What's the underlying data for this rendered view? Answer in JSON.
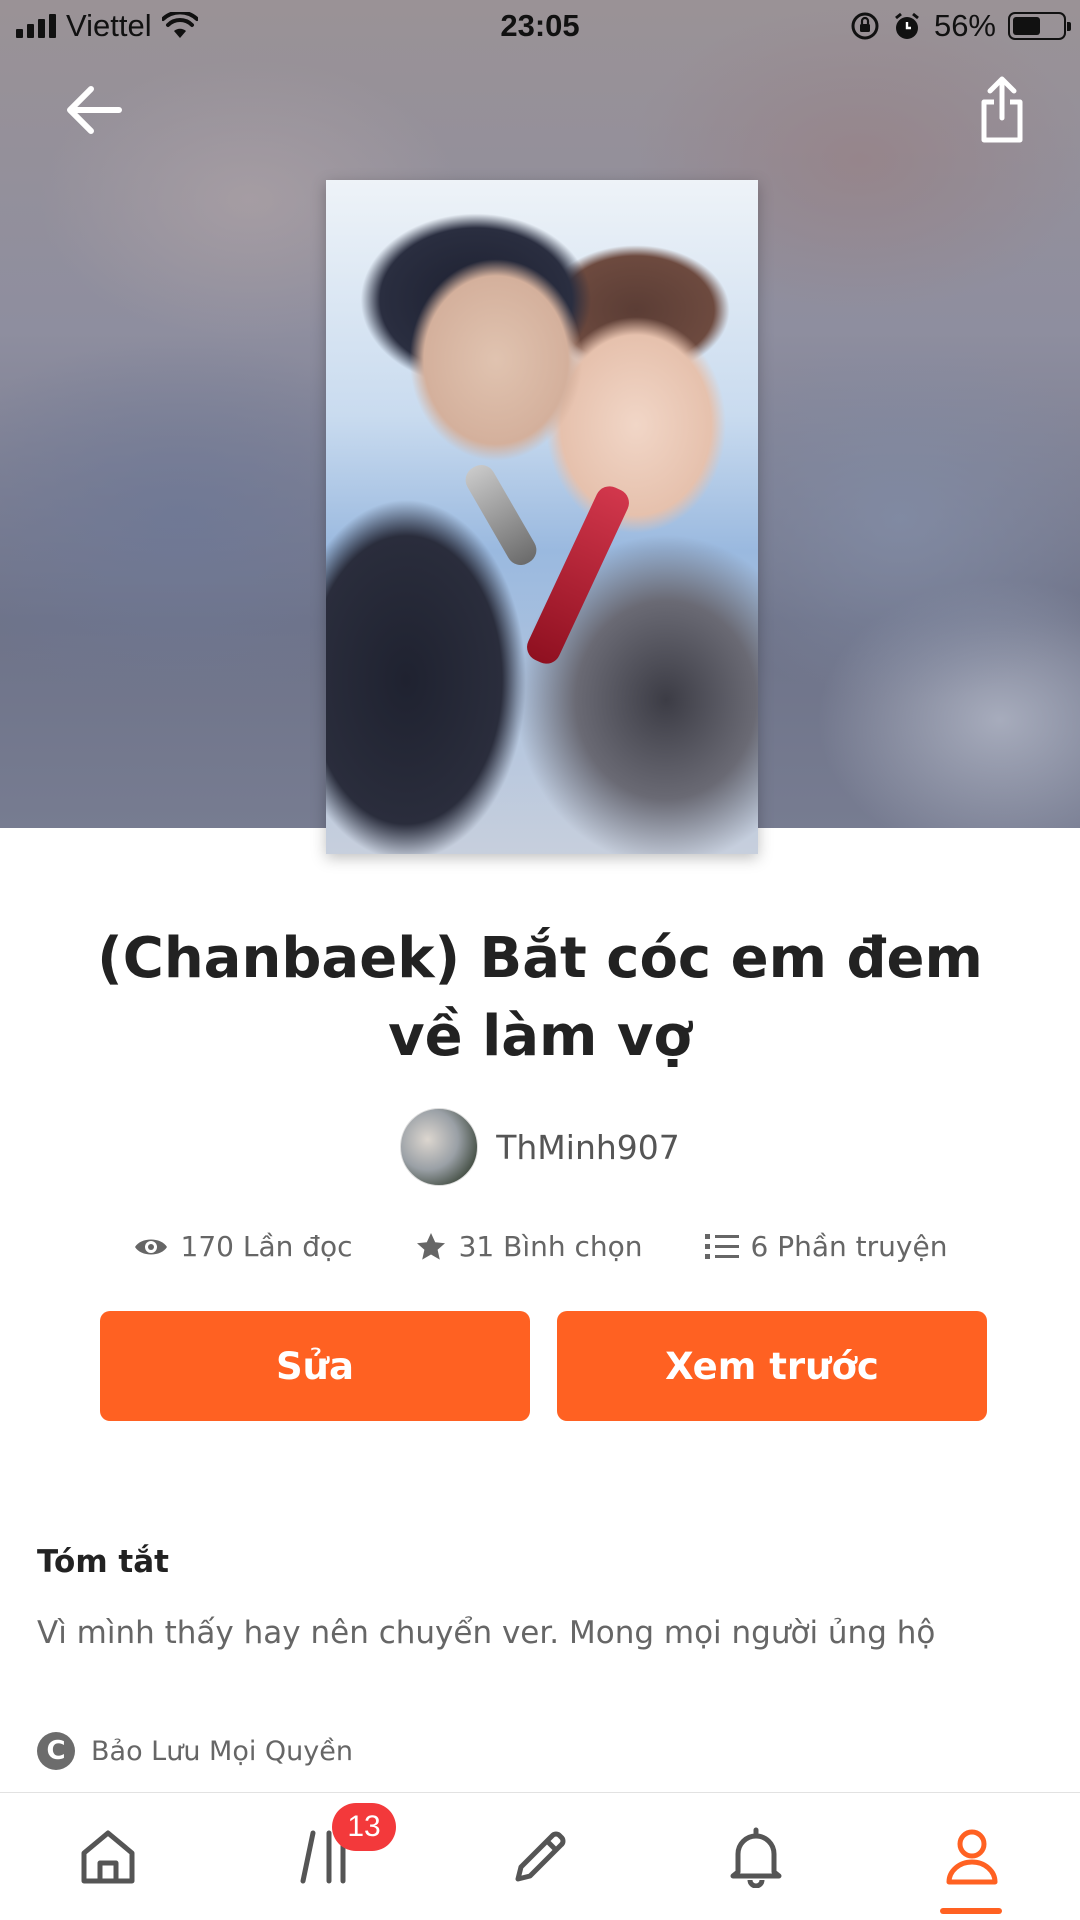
{
  "status_bar": {
    "carrier": "Viettel",
    "time": "23:05",
    "battery": "56%",
    "battery_level": 0.56
  },
  "header": {
    "back_icon": "arrow-left-icon",
    "share_icon": "share-icon"
  },
  "story": {
    "title": "(Chanbaek) Bắt cóc em đem về làm vợ",
    "author": "ThMinh907",
    "stats": {
      "reads": "170 Lần đọc",
      "votes": "31 Bình chọn",
      "parts": "6 Phần truyện"
    }
  },
  "actions": {
    "edit_label": "Sửa",
    "preview_label": "Xem trước"
  },
  "summary": {
    "heading": "Tóm tắt",
    "text": "Vì mình thấy hay nên chuyển ver. Mong mọi người ủng hộ",
    "rights": "Bảo Lưu Mọi Quyền",
    "rights_icon_glyph": "C"
  },
  "tabbar": {
    "library_badge": "13",
    "active_tab": "profile",
    "accent": "#ff6122"
  }
}
